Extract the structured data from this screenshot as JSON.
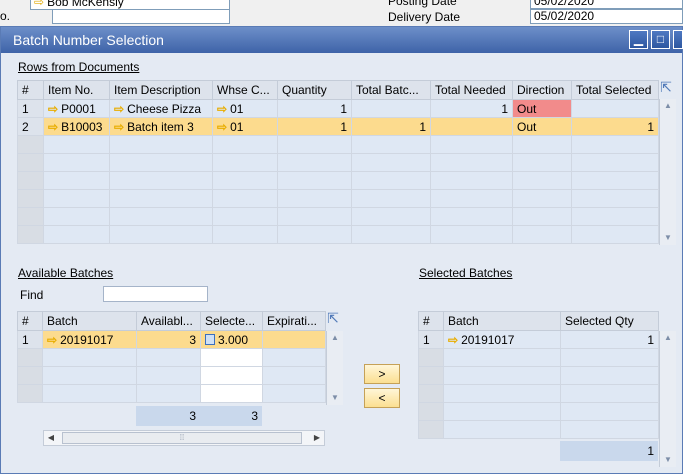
{
  "background": {
    "user_field": "Bob McKensly",
    "left_label": "o.",
    "posting_label": "Posting Date",
    "posting_value": "05/02/2020",
    "delivery_label": "Delivery Date",
    "delivery_value": "05/02/2020"
  },
  "window": {
    "title": "Batch Number Selection",
    "min_icon": "minimize-icon",
    "max_icon": "maximize-icon"
  },
  "rows_section": {
    "label": "Rows from Documents",
    "columns": [
      "#",
      "Item No.",
      "Item Description",
      "Whse C...",
      "Quantity",
      "Total Batc...",
      "Total Needed",
      "Direction",
      "Total Selected"
    ],
    "rows": [
      {
        "num": "1",
        "item_no": "P0001",
        "desc": "Cheese Pizza",
        "whse": "01",
        "qty": "1",
        "total_batch": "",
        "total_needed": "1",
        "direction": "Out",
        "total_selected": ""
      },
      {
        "num": "2",
        "item_no": "B10003",
        "desc": "Batch item 3",
        "whse": "01",
        "qty": "1",
        "total_batch": "1",
        "total_needed": "",
        "direction": "Out",
        "total_selected": "1"
      }
    ]
  },
  "available": {
    "label": "Available Batches",
    "find_label": "Find",
    "find_value": "",
    "columns": [
      "#",
      "Batch",
      "Availabl...",
      "Selecte...",
      "Expirati..."
    ],
    "rows": [
      {
        "num": "1",
        "batch": "20191017",
        "available": "3",
        "selected": "3.000",
        "expiration": ""
      }
    ],
    "total_available": "3",
    "total_selected": "3"
  },
  "selected": {
    "label": "Selected Batches",
    "columns": [
      "#",
      "Batch",
      "Selected Qty"
    ],
    "rows": [
      {
        "num": "1",
        "batch": "20191017",
        "qty": "1"
      }
    ],
    "total_qty": "1"
  },
  "buttons": {
    "add": ">",
    "remove": "<"
  }
}
